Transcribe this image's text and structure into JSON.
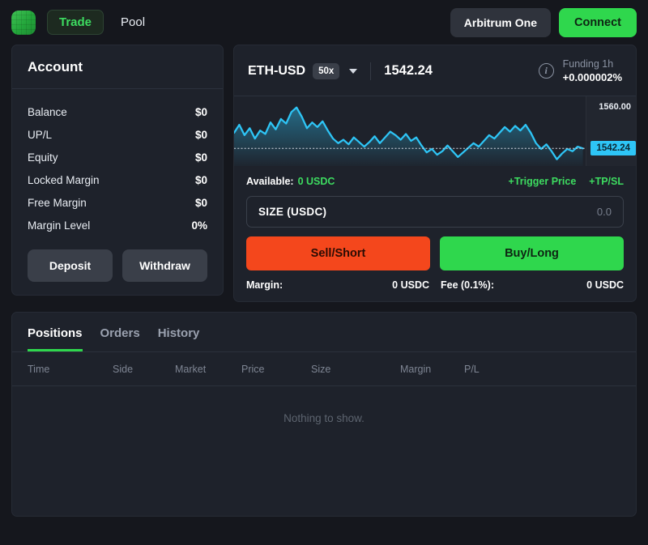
{
  "topbar": {
    "logo_icon": "app-logo-grid-icon",
    "nav": [
      {
        "label": "Trade",
        "active": true
      },
      {
        "label": "Pool",
        "active": false
      }
    ],
    "chain_label": "Arbitrum One",
    "connect_label": "Connect"
  },
  "account": {
    "title": "Account",
    "rows": [
      {
        "label": "Balance",
        "value": "$0"
      },
      {
        "label": "UP/L",
        "value": "$0"
      },
      {
        "label": "Equity",
        "value": "$0"
      },
      {
        "label": "Locked Margin",
        "value": "$0"
      },
      {
        "label": "Free Margin",
        "value": "$0"
      },
      {
        "label": "Margin Level",
        "value": "0%"
      }
    ],
    "deposit_label": "Deposit",
    "withdraw_label": "Withdraw"
  },
  "trade": {
    "pair": "ETH-USD",
    "leverage": "50x",
    "price": "1542.24",
    "info_icon": "info-circle-icon",
    "funding_label": "Funding 1h",
    "funding_value": "+0.000002%",
    "available_label": "Available:",
    "available_value": "0 USDC",
    "trigger_price_label": "+Trigger Price",
    "tpsl_label": "+TP/SL",
    "size_label": "SIZE (USDC)",
    "size_value": "0.0",
    "sell_label": "Sell/Short",
    "buy_label": "Buy/Long",
    "margin_label": "Margin:",
    "margin_value": "0 USDC",
    "fee_label": "Fee (0.1%):",
    "fee_value": "0 USDC"
  },
  "chart_data": {
    "type": "line",
    "title": "",
    "xlabel": "",
    "ylabel": "",
    "series": [
      {
        "name": "ETH-USD",
        "color": "#2ec5f6",
        "values": [
          1549.0,
          1552.5,
          1548.0,
          1551.0,
          1546.5,
          1550.0,
          1548.5,
          1553.5,
          1550.5,
          1555.0,
          1553.0,
          1558.0,
          1560.0,
          1556.0,
          1551.0,
          1553.5,
          1551.5,
          1554.0,
          1550.0,
          1546.5,
          1544.5,
          1546.0,
          1544.0,
          1547.0,
          1545.0,
          1543.0,
          1545.0,
          1547.5,
          1544.5,
          1547.0,
          1549.5,
          1548.0,
          1546.0,
          1548.5,
          1545.5,
          1547.0,
          1543.5,
          1540.5,
          1542.0,
          1539.5,
          1541.0,
          1543.5,
          1541.0,
          1538.5,
          1540.5,
          1542.5,
          1544.5,
          1543.0,
          1545.5,
          1548.0,
          1546.5,
          1549.0,
          1551.5,
          1549.5,
          1552.0,
          1550.0,
          1552.5,
          1549.0,
          1544.5,
          1542.0,
          1544.0,
          1541.0,
          1537.5,
          1540.0,
          1542.0,
          1541.0,
          1543.0,
          1542.24
        ]
      }
    ],
    "axis_tick_label": "1560.00",
    "current_price_label": "1542.24",
    "ylim": [
      1536,
      1562
    ],
    "grid": false,
    "legend": "none"
  },
  "bottom": {
    "tabs": [
      {
        "label": "Positions",
        "active": true
      },
      {
        "label": "Orders",
        "active": false
      },
      {
        "label": "History",
        "active": false
      }
    ],
    "columns": [
      "Time",
      "Side",
      "Market",
      "Price",
      "Size",
      "Margin",
      "P/L"
    ],
    "empty_text": "Nothing to show."
  }
}
